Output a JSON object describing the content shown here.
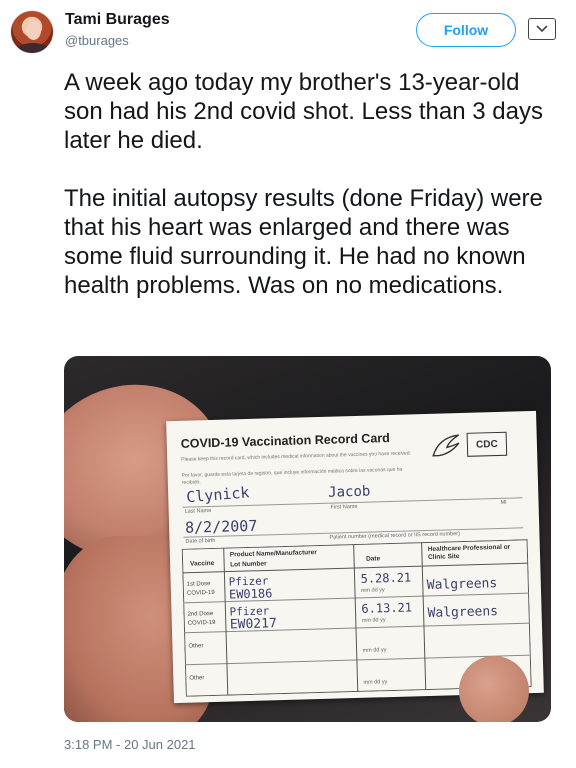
{
  "author": {
    "display_name": "Tami Burages",
    "handle": "@tburages",
    "follow_label": "Follow",
    "avatar_icon": "profile-photo",
    "menu_icon": "chevron-down-icon"
  },
  "tweet": {
    "text": "A week ago today my brother's 13-year-old son had his 2nd covid shot.  Less than 3 days later he died.\n\nThe initial autopsy results (done Friday) were that his heart was enlarged and there was some fluid surrounding it. He had no known health problems. Was on no medications.",
    "timestamp": "3:18 PM - 20 Jun 2021"
  },
  "photo": {
    "card_title": "COVID-19 Vaccination Record Card",
    "cdc_label": "CDC",
    "fine_print_en": "Please keep this record card, which includes medical information about the vaccines you have received.",
    "fine_print_es": "Por favor, guarde esta tarjeta de registro, que incluye información médica sobre las vacunas que ha recibido.",
    "last_name": "Clynick",
    "first_name": "Jacob",
    "dob": "8/2/2007",
    "last_name_label": "Last Name",
    "first_name_label": "First Name",
    "mi_label": "MI",
    "dob_label": "Date of birth",
    "patient_number_label": "Patient number (medical record or IIS record number)",
    "col_vaccine": "Vaccine",
    "col_product": "Product Name/Manufacturer",
    "col_lot": "Lot Number",
    "col_date": "Date",
    "col_site": "Healthcare Professional or Clinic Site",
    "rows": [
      {
        "label1": "1st Dose",
        "label2": "COVID-19",
        "product": "Pfizer",
        "lot": "EW0186",
        "date": "5.28.21",
        "site": "Walgreens"
      },
      {
        "label1": "2nd Dose",
        "label2": "COVID-19",
        "product": "Pfizer",
        "lot": "EW0217",
        "date": "6.13.21",
        "site": "Walgreens"
      },
      {
        "label1": "Other",
        "label2": "",
        "product": "",
        "lot": "",
        "date": "",
        "site": ""
      },
      {
        "label1": "Other",
        "label2": "",
        "product": "",
        "lot": "",
        "date": "",
        "site": ""
      }
    ],
    "date_hint": "mm   dd   yy"
  }
}
